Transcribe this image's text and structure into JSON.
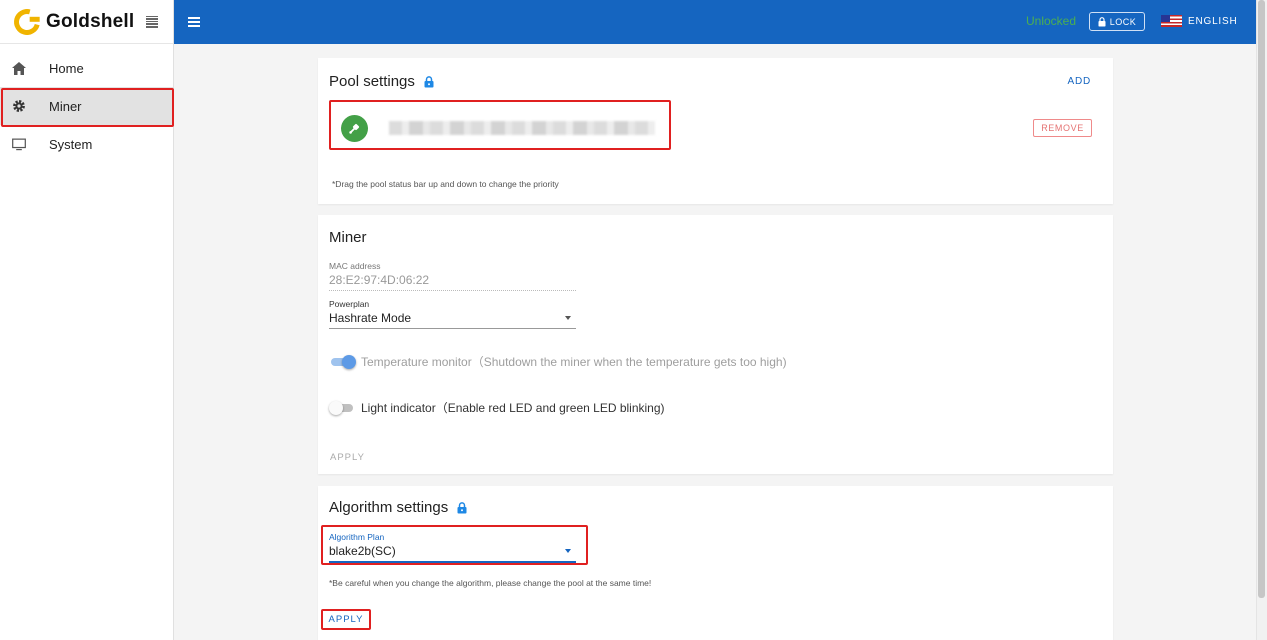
{
  "brand": {
    "name": "Goldshell"
  },
  "sidebar": {
    "items": [
      {
        "label": "Home",
        "icon": "home-icon"
      },
      {
        "label": "Miner",
        "icon": "gear-icon",
        "active": true
      },
      {
        "label": "System",
        "icon": "monitor-icon"
      }
    ]
  },
  "topbar": {
    "status": "Unlocked",
    "lock_label": "LOCK",
    "language": "ENGLISH"
  },
  "pool_settings": {
    "title": "Pool settings",
    "add_label": "ADD",
    "remove_label": "REMOVE",
    "note": "*Drag the pool status bar up and down to change the priority",
    "status_color": "#43a047"
  },
  "miner": {
    "title": "Miner",
    "mac_label": "MAC address",
    "mac_value": "28:E2:97:4D:06:22",
    "powerplan_label": "Powerplan",
    "powerplan_value": "Hashrate Mode",
    "temperature_monitor": {
      "label": "Temperature monitor（Shutdown the miner when the temperature gets too high)",
      "enabled": true
    },
    "light_indicator": {
      "label": "Light indicator（Enable red LED and green LED blinking)",
      "enabled": false
    },
    "apply_label": "APPLY"
  },
  "algorithm": {
    "title": "Algorithm settings",
    "plan_label": "Algorithm Plan",
    "plan_value": "blake2b(SC)",
    "note": "*Be careful when you change the algorithm, please change the pool at the same time!",
    "apply_label": "APPLY"
  },
  "colors": {
    "primary": "#1565c0",
    "highlight": "#e02020",
    "unlocked": "#4caf50"
  }
}
